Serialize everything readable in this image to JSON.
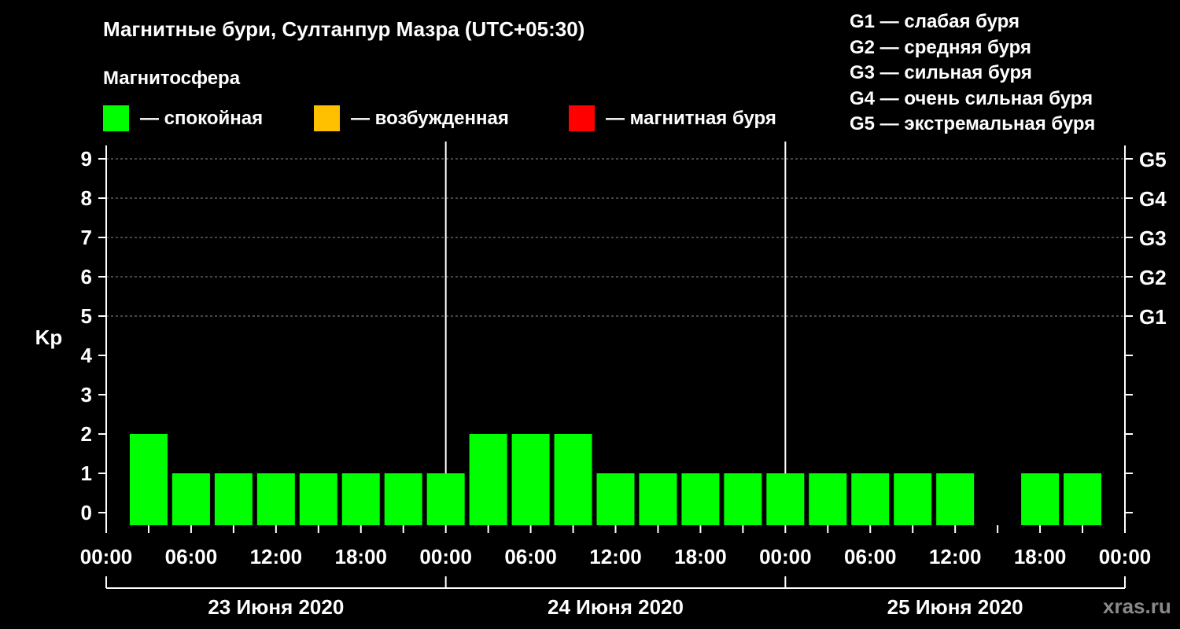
{
  "title": "Магнитные бури, Султанпур Мазра (UTC+05:30)",
  "subtitle": "Магнитосфера",
  "legend": [
    {
      "label": "— спокойная",
      "color": "#00ff00"
    },
    {
      "label": "— возбужденная",
      "color": "#ffc000"
    },
    {
      "label": "— магнитная буря",
      "color": "#ff0000"
    }
  ],
  "g_scale": [
    "G1 — слабая буря",
    "G2 — средняя буря",
    "G3 — сильная буря",
    "G4 — очень сильная буря",
    "G5 — экстремальная буря"
  ],
  "watermark": "xras.ru",
  "chart_data": {
    "type": "bar",
    "ylabel": "Kp",
    "ylim": [
      0,
      9
    ],
    "yticks": [
      "0",
      "1",
      "2",
      "3",
      "4",
      "5",
      "6",
      "7",
      "8",
      "9"
    ],
    "right_ticks": [
      {
        "kp": 5,
        "label": "G1"
      },
      {
        "kp": 6,
        "label": "G2"
      },
      {
        "kp": 7,
        "label": "G3"
      },
      {
        "kp": 8,
        "label": "G4"
      },
      {
        "kp": 9,
        "label": "G5"
      }
    ],
    "grid": "dashed horizontal at Kp 5–9",
    "x_time_labels": [
      "00:00",
      "06:00",
      "12:00",
      "18:00",
      "00:00",
      "06:00",
      "12:00",
      "18:00",
      "00:00",
      "06:00",
      "12:00",
      "18:00",
      "00:00"
    ],
    "days": [
      "23 Июня 2020",
      "24 Июня 2020",
      "25 Июня 2020"
    ],
    "bar_hours": [
      3,
      6,
      9,
      12,
      15,
      18,
      21,
      24,
      27,
      30,
      33,
      36,
      39,
      42,
      45,
      48,
      51,
      54,
      57,
      60,
      63,
      66,
      69
    ],
    "values": [
      2,
      1,
      1,
      1,
      1,
      1,
      1,
      1,
      2,
      2,
      2,
      1,
      1,
      1,
      1,
      1,
      1,
      1,
      1,
      1,
      0,
      1,
      1
    ],
    "bar_color": "#00ff00"
  }
}
